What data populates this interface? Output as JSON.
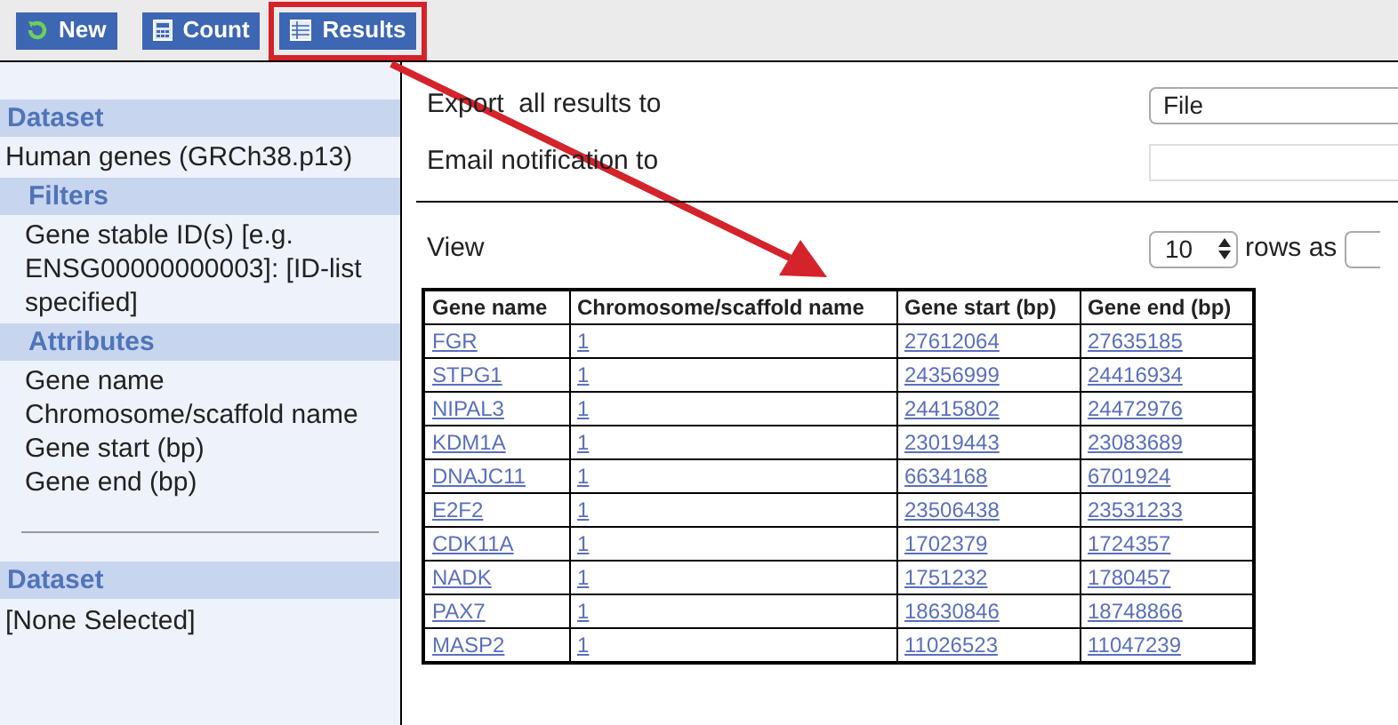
{
  "toolbar": {
    "buttons": [
      {
        "label": "New",
        "kind": "new",
        "highlighted": false
      },
      {
        "label": "Count",
        "kind": "count",
        "highlighted": false
      },
      {
        "label": "Results",
        "kind": "results",
        "highlighted": true
      }
    ]
  },
  "sidebar": {
    "sections": [
      {
        "header": "Dataset",
        "kind": "top",
        "lines": [
          "Human genes (GRCh38.p13)"
        ]
      },
      {
        "header": "Filters",
        "kind": "sub",
        "lines": [
          "Gene stable ID(s) [e.g. ENSG00000000003]: [ID-list specified]"
        ]
      },
      {
        "header": "Attributes",
        "kind": "sub",
        "lines": [
          "Gene name",
          "Chromosome/scaffold name",
          "Gene start (bp)",
          "Gene end (bp)"
        ]
      }
    ],
    "second_section": {
      "header": "Dataset",
      "lines": [
        "[None Selected]"
      ]
    }
  },
  "export": {
    "label": "Export  all results to",
    "value": "File"
  },
  "email": {
    "label": "Email notification to"
  },
  "view": {
    "label": "View",
    "rows": "10",
    "suffix": "rows as"
  },
  "table": {
    "columns": [
      "Gene name",
      "Chromosome/scaffold name",
      "Gene start (bp)",
      "Gene end (bp)"
    ],
    "rows": [
      [
        "FGR",
        "1",
        "27612064",
        "27635185"
      ],
      [
        "STPG1",
        "1",
        "24356999",
        "24416934"
      ],
      [
        "NIPAL3",
        "1",
        "24415802",
        "24472976"
      ],
      [
        "KDM1A",
        "1",
        "23019443",
        "23083689"
      ],
      [
        "DNAJC11",
        "1",
        "6634168",
        "6701924"
      ],
      [
        "E2F2",
        "1",
        "23506438",
        "23531233"
      ],
      [
        "CDK11A",
        "1",
        "1702379",
        "1724357"
      ],
      [
        "NADK",
        "1",
        "1751232",
        "1780457"
      ],
      [
        "PAX7",
        "1",
        "18630846",
        "18748866"
      ],
      [
        "MASP2",
        "1",
        "11026523",
        "11047239"
      ]
    ]
  }
}
